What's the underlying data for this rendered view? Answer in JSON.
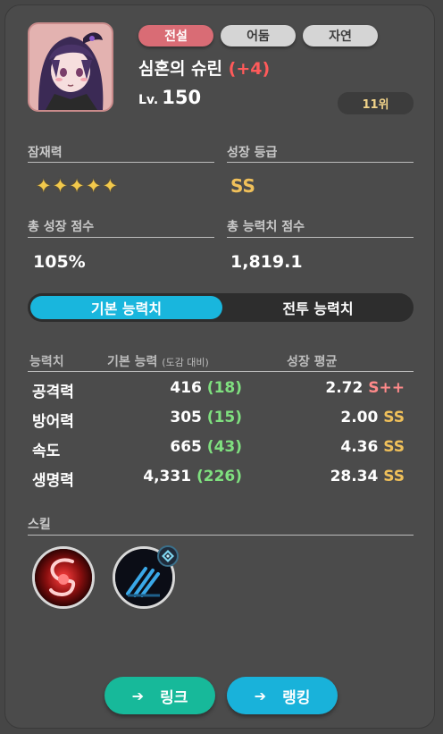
{
  "header": {
    "tags": [
      "전설",
      "어둠",
      "자연"
    ],
    "name": "심혼의 슈린",
    "plus": "(+4)",
    "level_prefix": "Lv.",
    "level": "150",
    "rank": "11위"
  },
  "potential": {
    "label": "잠재력",
    "stars": 5,
    "star_glyph": "✦"
  },
  "growth_grade": {
    "label": "성장 등급",
    "value": "SS"
  },
  "total_growth": {
    "label": "총 성장 점수",
    "value": "105%"
  },
  "total_stat": {
    "label": "총 능력치 점수",
    "value": "1,819.1"
  },
  "tabs": {
    "active": "기본 능력치",
    "inactive": "전투 능력치"
  },
  "stats_table": {
    "headers": {
      "stat": "능력치",
      "base": "기본 능력",
      "base_sub": "(도감 대비)",
      "growth": "성장 평균"
    },
    "rows": [
      {
        "name": "공격력",
        "base": "416",
        "diff": "(18)",
        "growth": "2.72",
        "grade": "S++"
      },
      {
        "name": "방어력",
        "base": "305",
        "diff": "(15)",
        "growth": "2.00",
        "grade": "SS"
      },
      {
        "name": "속도",
        "base": "665",
        "diff": "(43)",
        "growth": "4.36",
        "grade": "SS"
      },
      {
        "name": "생명력",
        "base": "4,331",
        "diff": "(226)",
        "growth": "28.34",
        "grade": "SS"
      }
    ]
  },
  "skills": {
    "label": "스킬",
    "icons": [
      "swirl-skill-icon",
      "claw-skill-icon"
    ]
  },
  "buttons": {
    "link": "링크",
    "ranking": "랭킹",
    "arrow": "➔"
  },
  "colors": {
    "accent_cyan": "#19b6dd",
    "teal_button": "#17b99a",
    "legend_tag": "#d96c75",
    "gold_grade": "#f0c05a",
    "plus_red": "#ff5a5a",
    "diff_green": "#7fe07f"
  }
}
